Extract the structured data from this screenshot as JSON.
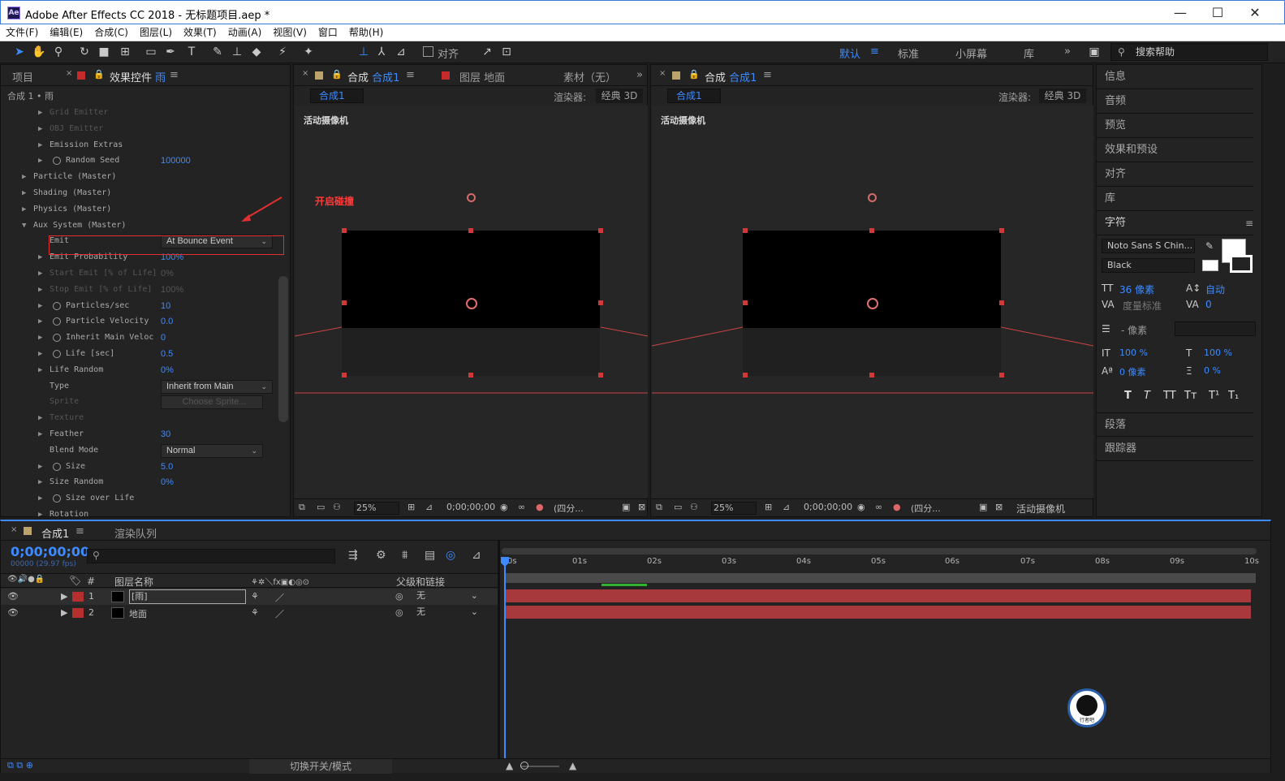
{
  "window": {
    "title": "Adobe After Effects CC 2018 - 无标题项目.aep *",
    "logo": "Ae",
    "minimize": "—",
    "maximize": "☐",
    "close": "✕"
  },
  "menu": [
    "文件(F)",
    "编辑(E)",
    "合成(C)",
    "图层(L)",
    "效果(T)",
    "动画(A)",
    "视图(V)",
    "窗口",
    "帮助(H)"
  ],
  "toolbar": {
    "align_label": "对齐",
    "workspaces": [
      "默认",
      "标准",
      "小屏幕",
      "库"
    ],
    "more": "»",
    "search_placeholder": "搜索帮助"
  },
  "project_panel": {
    "tab_project": "项目",
    "tab_effects": "效果控件",
    "effects_layer": "雨",
    "breadcrumb": "合成 1 • 雨"
  },
  "effects": [
    {
      "name": "Grid Emitter",
      "indent": 1,
      "dim": true
    },
    {
      "name": "OBJ Emitter",
      "indent": 1,
      "dim": true
    },
    {
      "name": "Emission Extras",
      "indent": 1
    },
    {
      "name": "Random Seed",
      "indent": 1,
      "stopwatch": true,
      "value": "100000"
    },
    {
      "name": "Particle (Master)",
      "indent": 0
    },
    {
      "name": "Shading (Master)",
      "indent": 0
    },
    {
      "name": "Physics (Master)",
      "indent": 0
    },
    {
      "name": "Aux System (Master)",
      "indent": 0,
      "open": true
    },
    {
      "name": "Emit",
      "indent": 2,
      "notwirl": true,
      "dropdown": "At Bounce Event",
      "highlight": true
    },
    {
      "name": "Emit Probability",
      "indent": 1,
      "value": "100%"
    },
    {
      "name": "Start Emit [% of Life]",
      "indent": 1,
      "value": "0%",
      "dim": true
    },
    {
      "name": "Stop Emit [% of Life]",
      "indent": 1,
      "value": "100%",
      "dim": true
    },
    {
      "name": "Particles/sec",
      "indent": 1,
      "stopwatch": true,
      "value": "10"
    },
    {
      "name": "Particle Velocity",
      "indent": 1,
      "stopwatch": true,
      "value": "0.0"
    },
    {
      "name": "Inherit Main Veloc",
      "indent": 1,
      "stopwatch": true,
      "value": "0"
    },
    {
      "name": "Life [sec]",
      "indent": 1,
      "stopwatch": true,
      "value": "0.5"
    },
    {
      "name": "Life Random",
      "indent": 1,
      "value": "0%"
    },
    {
      "name": "Type",
      "indent": 2,
      "notwirl": true,
      "dropdown": "Inherit from Main"
    },
    {
      "name": "Sprite",
      "indent": 2,
      "notwirl": true,
      "dim": true,
      "button": "Choose Sprite..."
    },
    {
      "name": "Texture",
      "indent": 1,
      "dim": true
    },
    {
      "name": "Feather",
      "indent": 1,
      "value": "30"
    },
    {
      "name": "Blend Mode",
      "indent": 2,
      "notwirl": true,
      "dropdown": "Normal"
    },
    {
      "name": "Size",
      "indent": 1,
      "stopwatch": true,
      "value": "5.0"
    },
    {
      "name": "Size Random",
      "indent": 1,
      "value": "0%"
    },
    {
      "name": "Size over Life",
      "indent": 1,
      "stopwatch": true
    },
    {
      "name": "Rotation",
      "indent": 1
    }
  ],
  "comp_panel": {
    "tab_prefix": "合成",
    "tab_name": "合成1",
    "layer_tab": "图层 地面",
    "footage_tab": "素材（无）",
    "comp_chip": "合成1",
    "renderer_label": "渲染器:",
    "renderer_value": "经典 3D",
    "camera_label": "活动摄像机",
    "annotation": "开启碰撞",
    "zoom": "25%",
    "timecode": "0;00;00;00",
    "quality": "(四分...",
    "camera_select": "活动摄像机"
  },
  "right_panel": {
    "items": [
      "信息",
      "音频",
      "预览",
      "效果和预设",
      "对齐",
      "库",
      "字符",
      "段落",
      "跟踪器"
    ],
    "font_family": "Noto Sans S Chin...",
    "font_style": "Black",
    "font_size": "36 像素",
    "leading": "自动",
    "kerning": "度量标准",
    "tracking": "0",
    "stroke": "- 像素",
    "vscale": "100 %",
    "hscale": "100 %",
    "baseline": "0 像素",
    "tsume": "0 %",
    "styles": [
      "T",
      "T",
      "TT",
      "Tт",
      "T¹",
      "T₁"
    ]
  },
  "timeline": {
    "tab": "合成1",
    "render_queue": "渲染队列",
    "timecode": "0;00;00;00",
    "fps": "00000 (29.97 fps)",
    "col_layer_name": "图层名称",
    "col_parent": "父级和链接",
    "col_num": "#",
    "ruler": [
      "0s",
      "01s",
      "02s",
      "03s",
      "04s",
      "05s",
      "06s",
      "07s",
      "08s",
      "09s",
      "10s"
    ],
    "layers": [
      {
        "num": "1",
        "name": "[雨]",
        "parent": "无",
        "color": "#b52f2f"
      },
      {
        "num": "2",
        "name": "地面",
        "parent": "无",
        "color": "#b52f2f"
      }
    ],
    "switch_mode": "切换开关/模式",
    "watermark": "行者吧"
  },
  "colors": {
    "accent": "#3d8bff",
    "label_red": "#b52f2f",
    "highlight_box": "#e03030",
    "track_bar": "#a7393d"
  }
}
